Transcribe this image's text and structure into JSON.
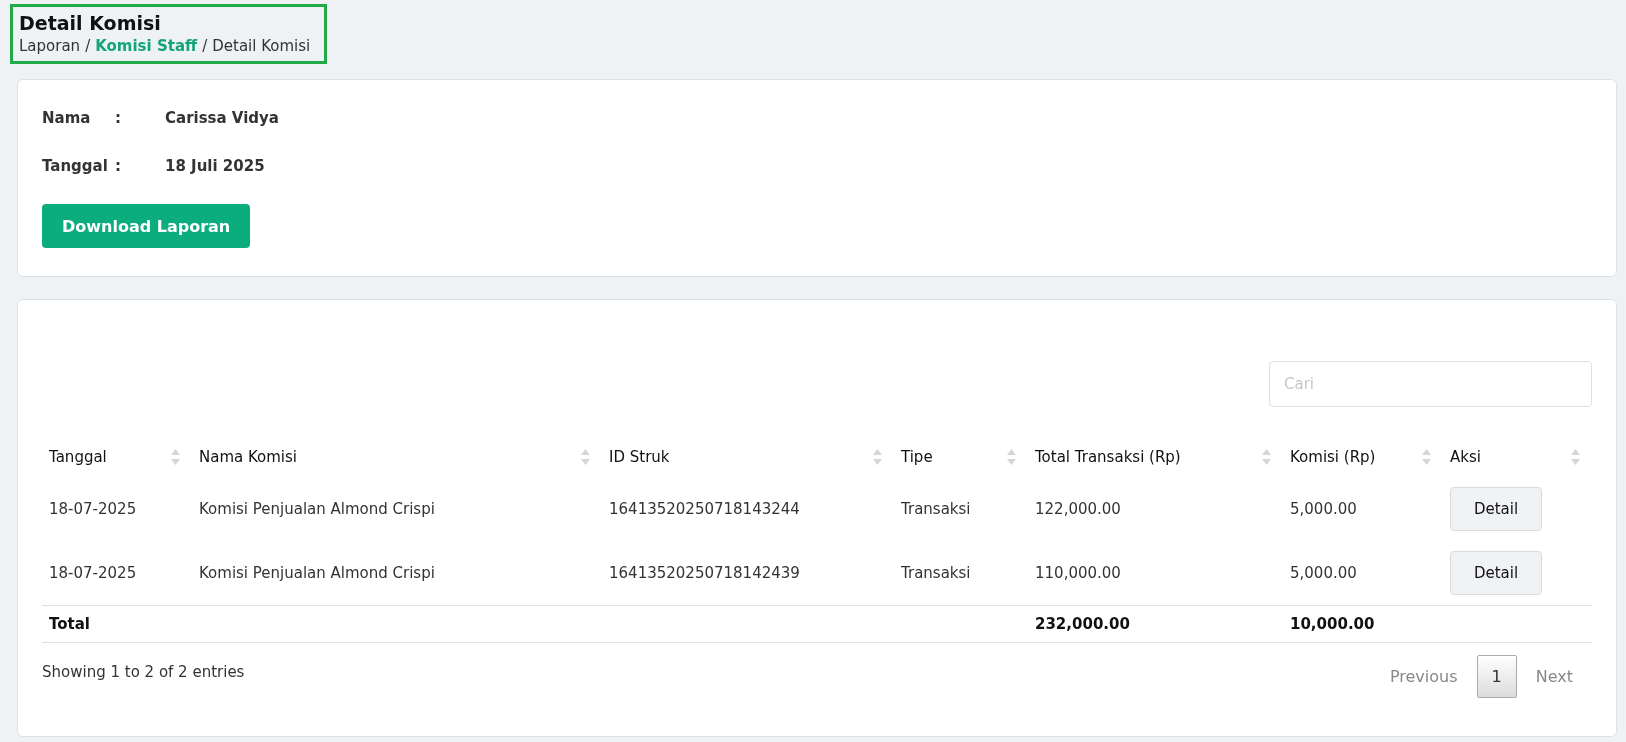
{
  "header": {
    "title": "Detail Komisi",
    "separator": "/",
    "breadcrumb": [
      {
        "label": "Laporan",
        "kind": "text"
      },
      {
        "label": "Komisi Staff",
        "kind": "link"
      },
      {
        "label": "Detail Komisi",
        "kind": "text"
      }
    ]
  },
  "info": {
    "fields": [
      {
        "label": "Nama",
        "separator": ":",
        "value": "Carissa Vidya"
      },
      {
        "label": "Tanggal",
        "separator": ":",
        "value": "18 Juli 2025"
      }
    ],
    "button": "Download Laporan"
  },
  "table": {
    "search": {
      "placeholder": "Cari"
    },
    "columns": [
      "Tanggal",
      "Nama Komisi",
      "ID Struk",
      "Tipe",
      "Total Transaksi (Rp)",
      "Komisi (Rp)",
      "Aksi"
    ],
    "rows": [
      {
        "cells": [
          "18-07-2025",
          "Komisi Penjualan Almond Crispi",
          "16413520250718143244",
          "Transaksi",
          "122,000.00",
          "5,000.00"
        ],
        "action": "Detail"
      },
      {
        "cells": [
          "18-07-2025",
          "Komisi Penjualan Almond Crispi",
          "16413520250718142439",
          "Transaksi",
          "110,000.00",
          "5,000.00"
        ],
        "action": "Detail"
      }
    ],
    "footer": {
      "label": "Total",
      "total_transaksi": "232,000.00",
      "komisi": "10,000.00"
    },
    "info_text": "Showing 1 to 2 of 2 entries",
    "pagination": [
      {
        "label": "Previous",
        "disabled": true,
        "selected": false
      },
      {
        "label": "1",
        "disabled": false,
        "selected": true
      },
      {
        "label": "Next",
        "disabled": true,
        "selected": false
      }
    ]
  }
}
